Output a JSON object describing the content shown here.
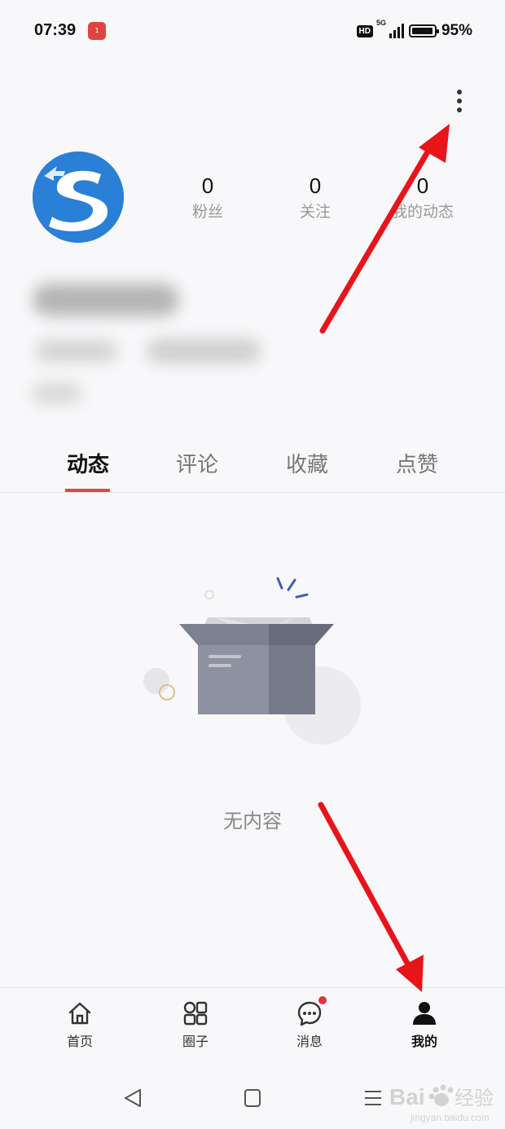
{
  "status_bar": {
    "time": "07:39",
    "notification_badge": "1",
    "hd": "HD",
    "network": "5G",
    "battery": "95%"
  },
  "profile": {
    "stats": [
      {
        "value": "0",
        "label": "粉丝"
      },
      {
        "value": "0",
        "label": "关注"
      },
      {
        "value": "0",
        "label": "我的动态"
      }
    ]
  },
  "tabs": [
    {
      "label": "动态",
      "active": true
    },
    {
      "label": "评论",
      "active": false
    },
    {
      "label": "收藏",
      "active": false
    },
    {
      "label": "点赞",
      "active": false
    }
  ],
  "empty_state": {
    "text": "无内容"
  },
  "bottom_nav": [
    {
      "label": "首页",
      "icon": "home-icon"
    },
    {
      "label": "圈子",
      "icon": "grid-icon"
    },
    {
      "label": "消息",
      "icon": "chat-icon",
      "has_unread_dot": true
    },
    {
      "label": "我的",
      "icon": "person-icon",
      "active": true
    }
  ],
  "colors": {
    "accent": "#d94a44",
    "annotation_arrow": "#e8141a",
    "avatar_blue": "#2a7fd6",
    "box_gray": "#8e919f"
  },
  "watermark": "Baidu经验 jingyan.baidu.com"
}
